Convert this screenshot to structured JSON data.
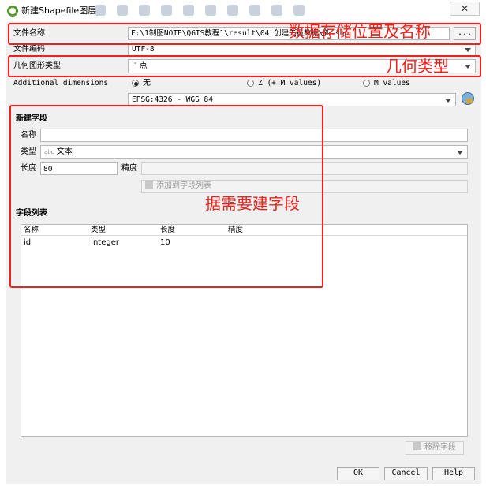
{
  "window": {
    "title": "新建Shapefile图层",
    "close_label": "✕"
  },
  "file_name": {
    "label": "文件名称",
    "value": "F:\\1制图NOTE\\QGIS教程1\\result\\04 创建矢量数据\\新.shp",
    "browse_label": "..."
  },
  "encoding": {
    "label": "文件编码",
    "value": "UTF-8"
  },
  "geometry_type": {
    "label": "几何图形类型",
    "value": "点"
  },
  "dimensions": {
    "label": "Additional dimensions",
    "options": [
      {
        "label": "无",
        "selected": true
      },
      {
        "label": "Z (+ M values)",
        "selected": false
      },
      {
        "label": "M values",
        "selected": false
      }
    ]
  },
  "crs": {
    "value": "EPSG:4326 - WGS 84"
  },
  "new_field": {
    "section_title": "新建字段",
    "name_label": "名称",
    "name_value": "",
    "type_label": "类型",
    "type_prefix": "abc",
    "type_value": "文本",
    "length_label": "长度",
    "length_value": "80",
    "precision_label": "精度",
    "precision_value": "",
    "add_button": "添加到字段列表"
  },
  "field_list": {
    "section_title": "字段列表",
    "columns": [
      "名称",
      "类型",
      "长度",
      "精度"
    ],
    "rows": [
      {
        "name": "id",
        "type": "Integer",
        "length": "10",
        "precision": ""
      }
    ],
    "remove_button": "移除字段"
  },
  "buttons": {
    "ok": "OK",
    "cancel": "Cancel",
    "help": "Help"
  },
  "annotations": {
    "file": "数据存储位置及名称",
    "geometry": "几何类型",
    "fields": "据需要建字段",
    "color": "#f0201a"
  }
}
